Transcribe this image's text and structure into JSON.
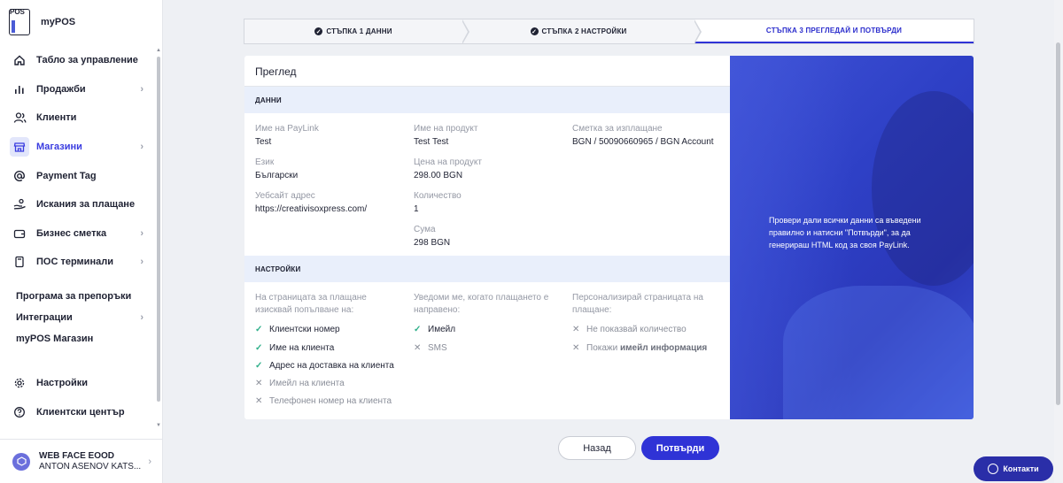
{
  "brand": {
    "logo_text": "POS",
    "name": "myPOS"
  },
  "sidebar": {
    "items": [
      {
        "label": "Табло за управление",
        "icon": "home-icon",
        "chevron": false
      },
      {
        "label": "Продажби",
        "icon": "bar-chart-icon",
        "chevron": true
      },
      {
        "label": "Клиенти",
        "icon": "users-icon",
        "chevron": false
      },
      {
        "label": "Магазини",
        "icon": "store-icon",
        "chevron": true,
        "active": true
      },
      {
        "label": "Payment Tag",
        "icon": "at-sign-icon",
        "chevron": false
      },
      {
        "label": "Искания за плащане",
        "icon": "hand-money-icon",
        "chevron": false
      },
      {
        "label": "Бизнес сметка",
        "icon": "wallet-icon",
        "chevron": true
      },
      {
        "label": "ПОС терминали",
        "icon": "terminal-icon",
        "chevron": true
      }
    ],
    "plain_items": [
      {
        "label": "Програма за препоръки",
        "chevron": false
      },
      {
        "label": "Интеграции",
        "chevron": true
      },
      {
        "label": "myPOS Магазин",
        "chevron": false
      }
    ],
    "bottom_items": [
      {
        "label": "Настройки",
        "icon": "gear-icon"
      },
      {
        "label": "Клиентски център",
        "icon": "help-icon"
      }
    ],
    "account": {
      "company": "WEB FACE EOOD",
      "user": "ANTON ASENOV KATS..."
    }
  },
  "stepper": {
    "step1": "СТЪПКА 1 ДАННИ",
    "step2": "СТЪПКА 2 НАСТРОЙКИ",
    "step3": "СТЪПКА 3 ПРЕГЛЕДАЙ И ПОТВЪРДИ"
  },
  "review": {
    "title": "Преглед",
    "data_section": "ДАННИ",
    "settings_section": "НАСТРОЙКИ",
    "fields": {
      "paylink_name": {
        "label": "Име на PayLink",
        "value": "Test"
      },
      "language": {
        "label": "Език",
        "value": "Български"
      },
      "website": {
        "label": "Уебсайт адрес",
        "value": "https://creativisoxpress.com/"
      },
      "product_name": {
        "label": "Име на продукт",
        "value": "Test Test"
      },
      "product_price": {
        "label": "Цена на продукт",
        "value": "298.00 BGN"
      },
      "quantity": {
        "label": "Количество",
        "value": "1"
      },
      "amount": {
        "label": "Сума",
        "value": "298 BGN"
      },
      "payment_account": {
        "label": "Сметка за изплащане",
        "value": "BGN / 50090660965 / BGN Account"
      }
    },
    "settings": {
      "required_head": "На страницата за плащане изисквай попълване на:",
      "required": [
        {
          "label": "Клиентски номер",
          "on": true
        },
        {
          "label": "Име на клиента",
          "on": true
        },
        {
          "label": "Адрес на доставка на клиента",
          "on": true
        },
        {
          "label": "Имейл на клиента",
          "on": false
        },
        {
          "label": "Телефонен номер на клиента",
          "on": false
        }
      ],
      "notify_head": "Уведоми ме, когато плащането е направено:",
      "notify": [
        {
          "label": "Имейл",
          "on": true
        },
        {
          "label": "SMS",
          "on": false
        }
      ],
      "customize_head": "Персонализирай страницата на плащане:",
      "customize": [
        {
          "label": "Не показвай количество",
          "on": false
        },
        {
          "label_prefix": "Покажи ",
          "label_bold": "имейл информация",
          "on": false
        }
      ]
    }
  },
  "promo": {
    "text": "Провери дали всички данни са въведени правилно и натисни \"Потвърди\", за да генерираш HTML код за своя PayLink."
  },
  "buttons": {
    "back": "Назад",
    "confirm": "Потвърди"
  },
  "contacts": {
    "label": "Контакти"
  },
  "colors": {
    "accent": "#2f33d6",
    "check": "#2fb08a",
    "section_bg": "#e9effb",
    "promo": "#3e52d6"
  }
}
